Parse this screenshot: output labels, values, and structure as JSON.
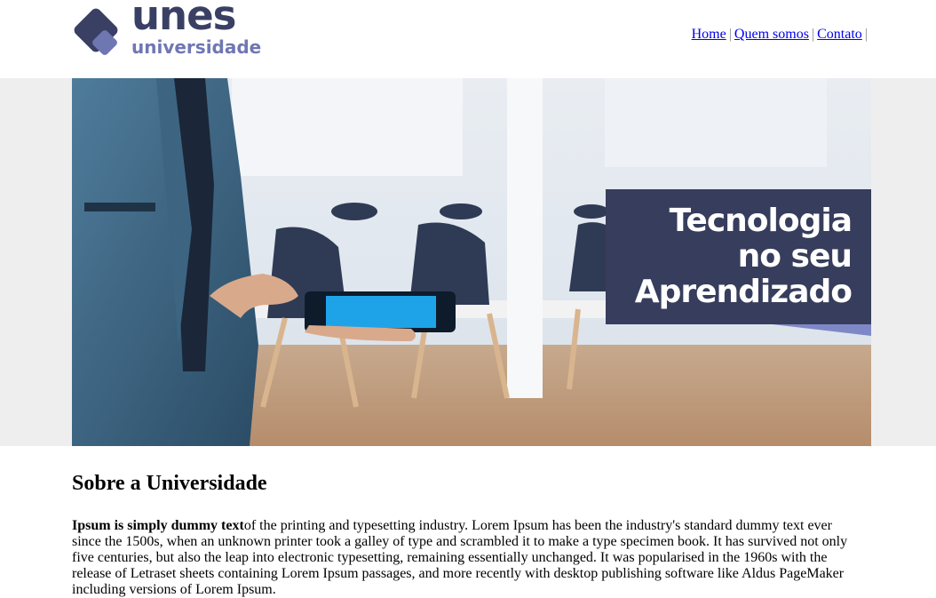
{
  "brand": {
    "name": "unes",
    "subtitle": "universidade",
    "colors": {
      "dark": "#3a4064",
      "light": "#6f77b3"
    }
  },
  "nav": {
    "items": [
      "Home",
      "Quem somos",
      "Contato"
    ],
    "separator": "|"
  },
  "banner": {
    "tagline": [
      "Tecnologia",
      "no seu",
      "Aprendizado"
    ],
    "tagline_bg": "#373d5c"
  },
  "about": {
    "title": "Sobre a Universidade",
    "lead": "Ipsum is simply dummy text",
    "body": "of the printing and typesetting industry. Lorem Ipsum has been the industry's standard dummy text ever since the 1500s, when an unknown printer took a galley of type and scrambled it to make a type specimen book. It has survived not only five centuries, but also the leap into electronic typesetting, remaining essentially unchanged. It was popularised in the 1960s with the release of Letraset sheets containing Lorem Ipsum passages, and more recently with desktop publishing software like Aldus PageMaker including versions of Lorem Ipsum."
  }
}
